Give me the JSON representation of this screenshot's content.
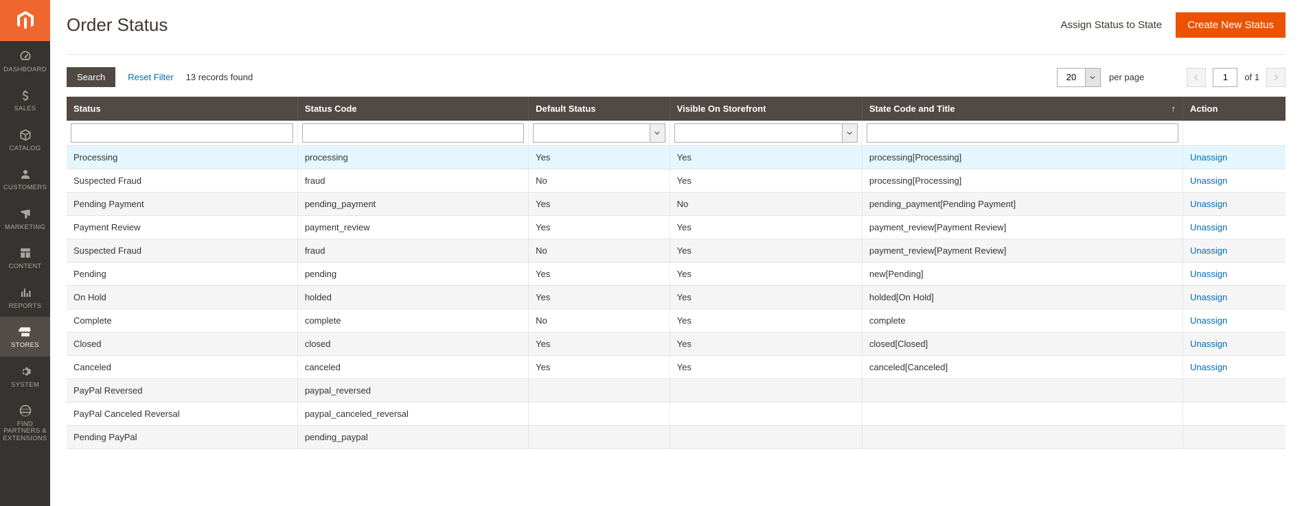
{
  "sidebar": {
    "items": [
      {
        "label": "Dashboard"
      },
      {
        "label": "Sales"
      },
      {
        "label": "Catalog"
      },
      {
        "label": "Customers"
      },
      {
        "label": "Marketing"
      },
      {
        "label": "Content"
      },
      {
        "label": "Reports"
      },
      {
        "label": "Stores"
      },
      {
        "label": "System"
      },
      {
        "label": "Find Partners & Extensions"
      }
    ]
  },
  "header": {
    "title": "Order Status",
    "assign_label": "Assign Status to State",
    "create_label": "Create New Status"
  },
  "toolbar": {
    "search_label": "Search",
    "reset_label": "Reset Filter",
    "records_text": "13 records found",
    "page_size": "20",
    "per_page_label": "per page",
    "current_page": "1",
    "of_label": "of 1"
  },
  "columns": {
    "status": "Status",
    "code": "Status Code",
    "default": "Default Status",
    "visible": "Visible On Storefront",
    "state": "State Code and Title",
    "action": "Action"
  },
  "action_link": "Unassign",
  "rows": [
    {
      "status": "Processing",
      "code": "processing",
      "default": "Yes",
      "visible": "Yes",
      "state": "processing[Processing]",
      "action": true,
      "highlight": true
    },
    {
      "status": "Suspected Fraud",
      "code": "fraud",
      "default": "No",
      "visible": "Yes",
      "state": "processing[Processing]",
      "action": true
    },
    {
      "status": "Pending Payment",
      "code": "pending_payment",
      "default": "Yes",
      "visible": "No",
      "state": "pending_payment[Pending Payment]",
      "action": true
    },
    {
      "status": "Payment Review",
      "code": "payment_review",
      "default": "Yes",
      "visible": "Yes",
      "state": "payment_review[Payment Review]",
      "action": true
    },
    {
      "status": "Suspected Fraud",
      "code": "fraud",
      "default": "No",
      "visible": "Yes",
      "state": "payment_review[Payment Review]",
      "action": true
    },
    {
      "status": "Pending",
      "code": "pending",
      "default": "Yes",
      "visible": "Yes",
      "state": "new[Pending]",
      "action": true
    },
    {
      "status": "On Hold",
      "code": "holded",
      "default": "Yes",
      "visible": "Yes",
      "state": "holded[On Hold]",
      "action": true
    },
    {
      "status": "Complete",
      "code": "complete",
      "default": "No",
      "visible": "Yes",
      "state": "complete",
      "action": true
    },
    {
      "status": "Closed",
      "code": "closed",
      "default": "Yes",
      "visible": "Yes",
      "state": "closed[Closed]",
      "action": true
    },
    {
      "status": "Canceled",
      "code": "canceled",
      "default": "Yes",
      "visible": "Yes",
      "state": "canceled[Canceled]",
      "action": true
    },
    {
      "status": "PayPal Reversed",
      "code": "paypal_reversed",
      "default": "",
      "visible": "",
      "state": "",
      "action": false
    },
    {
      "status": "PayPal Canceled Reversal",
      "code": "paypal_canceled_reversal",
      "default": "",
      "visible": "",
      "state": "",
      "action": false
    },
    {
      "status": "Pending PayPal",
      "code": "pending_paypal",
      "default": "",
      "visible": "",
      "state": "",
      "action": false
    }
  ]
}
